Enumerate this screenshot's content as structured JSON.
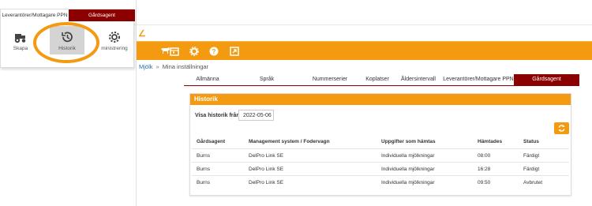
{
  "menu": {
    "tabs": [
      {
        "label": "Leverantörer/Mottagare PPN",
        "active": false
      },
      {
        "label": "Gårdsagent",
        "active": true
      }
    ],
    "items": [
      {
        "label": "Skapa",
        "icon": "tractor-icon",
        "selected": false
      },
      {
        "label": "Historik",
        "icon": "history-icon",
        "selected": true
      },
      {
        "label": "Administrering",
        "visible_label": "ministrering",
        "icon": "gear-icon",
        "selected": false
      }
    ]
  },
  "toolbar": {
    "icons": [
      "cow-icon",
      "calendar-icon",
      "gear-icon",
      "help-icon",
      "export-icon"
    ],
    "accent": "#f49a10"
  },
  "breadcrumb": {
    "link": "Mjölk",
    "separator": "»",
    "current": "Mina inställningar"
  },
  "tabs": [
    {
      "label": "Allmänna",
      "active": false
    },
    {
      "label": "Språk",
      "active": false
    },
    {
      "label": "Nummerserier",
      "active": false
    },
    {
      "label": "Koplatser",
      "active": false
    },
    {
      "label": "Åldersintervall",
      "active": false
    },
    {
      "label": "Leverantörer/Mottagare PPN",
      "active": false
    },
    {
      "label": "Gårdsagent",
      "active": true
    }
  ],
  "panel": {
    "title": "Historik",
    "filter_label": "Visa historik från",
    "filter_date": "2022-05-06",
    "columns": [
      "Gårdsagent",
      "Management system / Fodervagn",
      "Uppgifter som hämtas",
      "Hämtades",
      "Status"
    ],
    "rows": [
      [
        "Burns",
        "DelPro Link SE",
        "Individuella mjölkningar",
        "08:00",
        "Färdigt"
      ],
      [
        "Burns",
        "DelPro Link SE",
        "Individuella mjölkningar",
        "16:28",
        "Färdigt"
      ],
      [
        "Burns",
        "DelPro Link SE",
        "Individuella mjölkningar",
        "09:50",
        "Avbrutet"
      ]
    ]
  },
  "colors": {
    "accent": "#f49a10",
    "active_tab": "#8b0000"
  }
}
